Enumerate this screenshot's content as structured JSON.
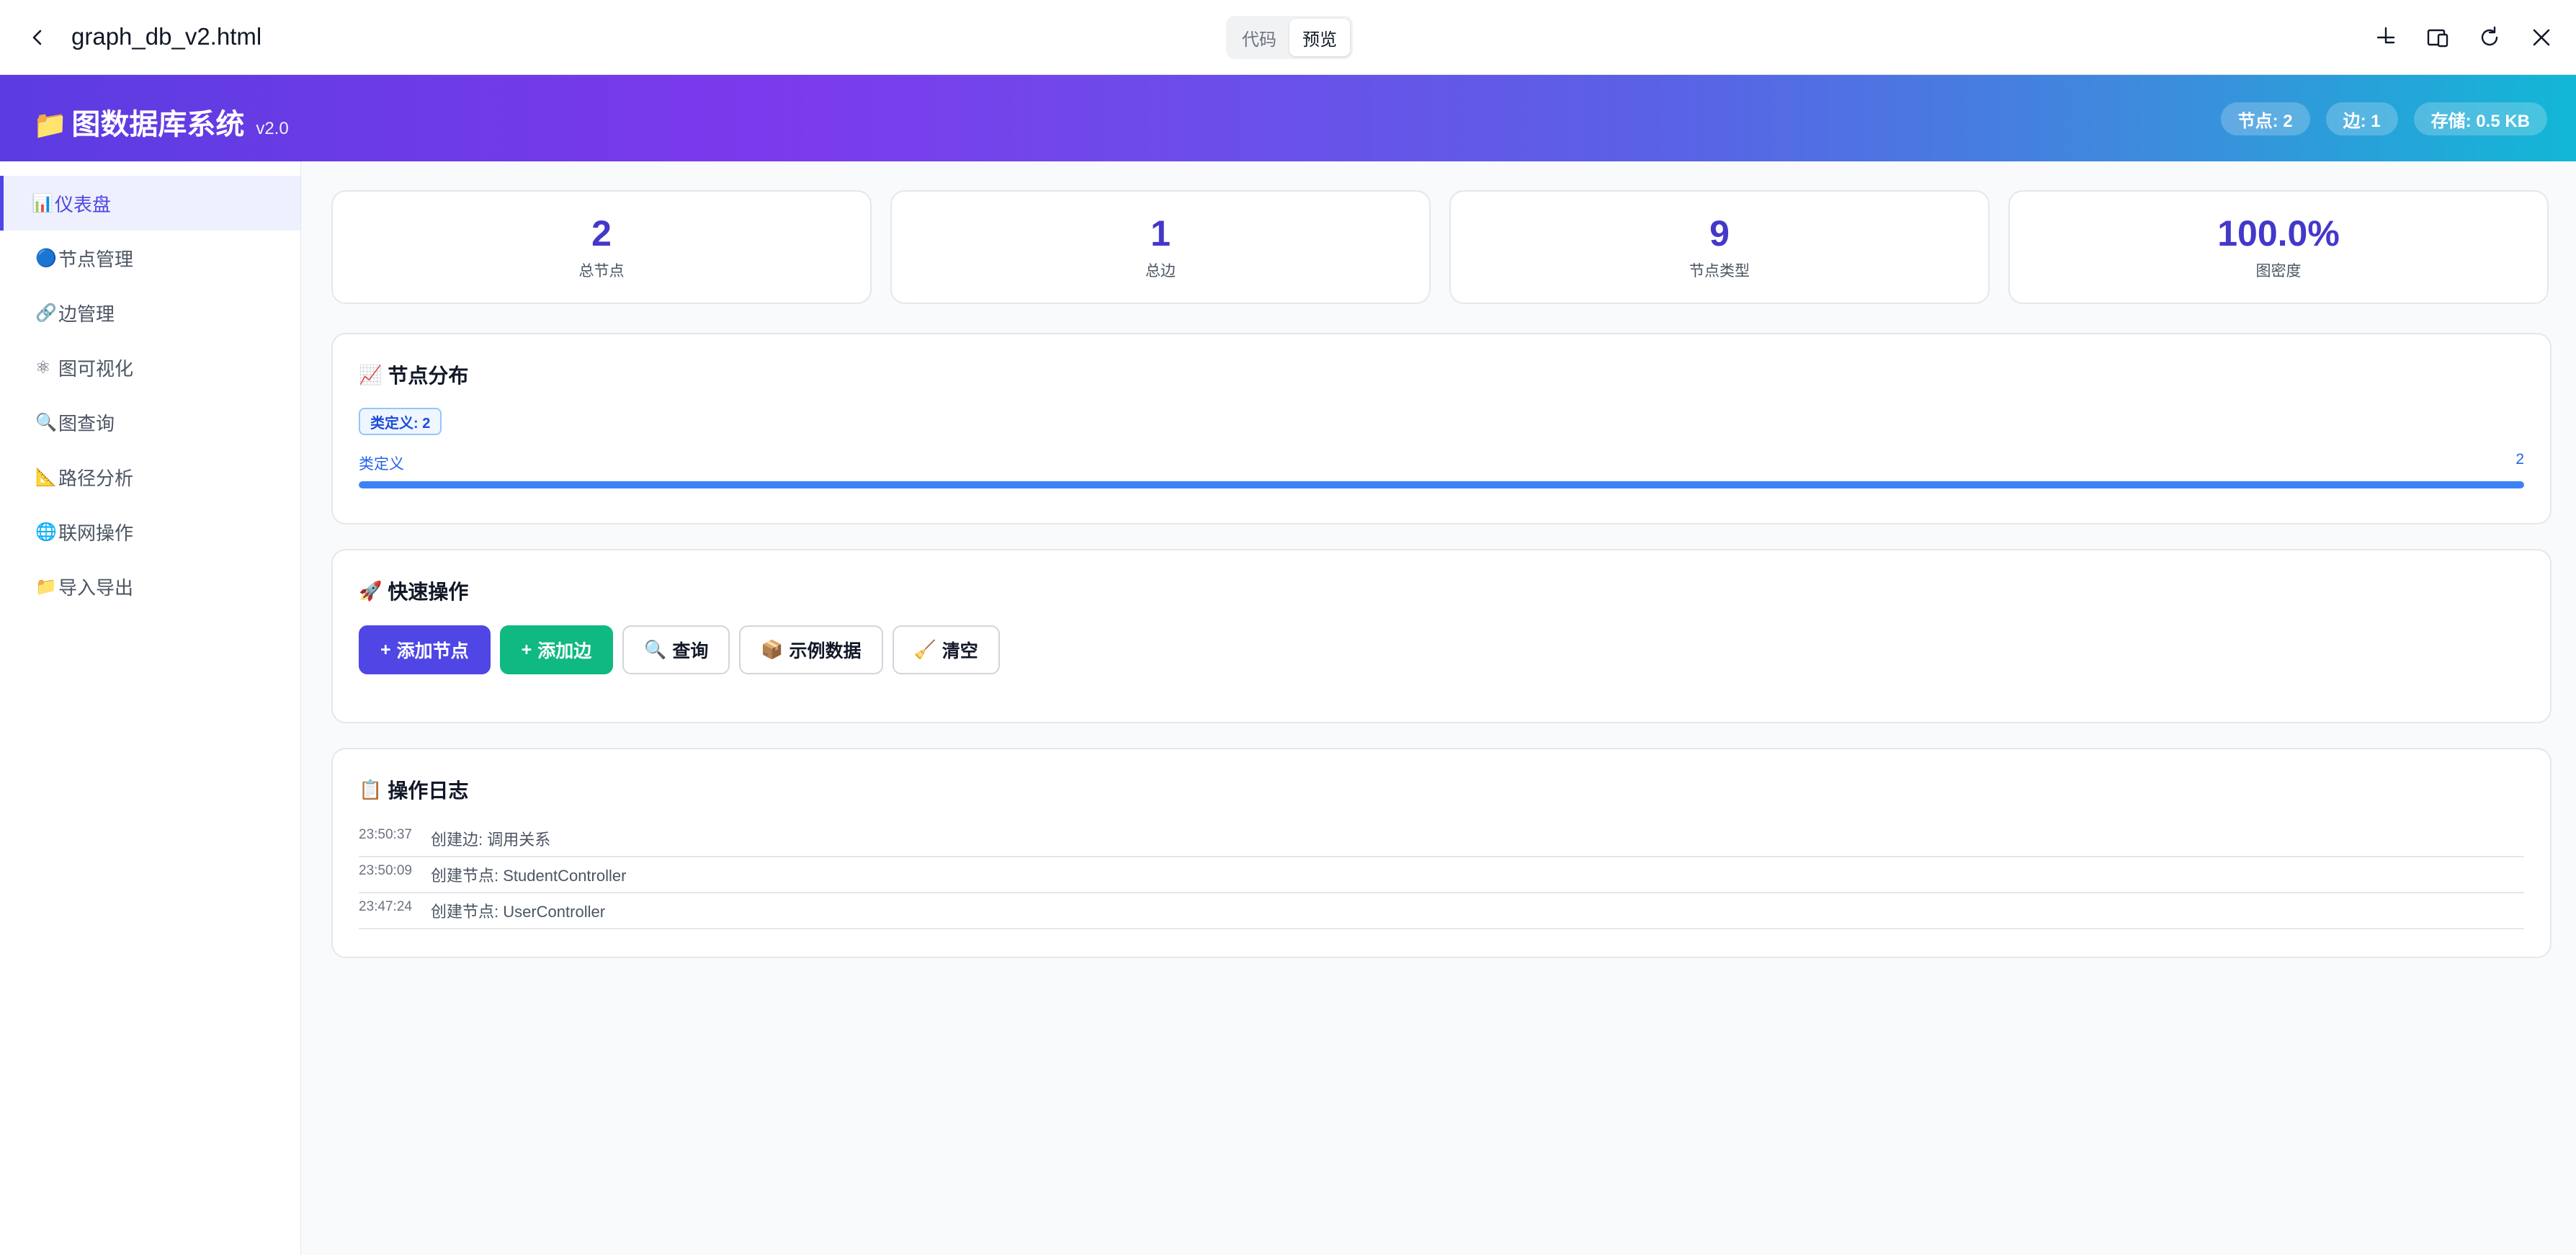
{
  "topbar": {
    "file_name": "graph_db_v2.html",
    "tabs": [
      {
        "label": "代码",
        "active": false
      },
      {
        "label": "预览",
        "active": true
      }
    ]
  },
  "header": {
    "icon": "📁",
    "title": "图数据库系统",
    "version": "v2.0",
    "stats": {
      "nodes": "节点: 2",
      "edges": "边: 1",
      "storage": "存储: 0.5 KB"
    }
  },
  "sidebar": {
    "items": [
      {
        "icon": "📊",
        "label": "仪表盘",
        "active": true
      },
      {
        "icon": "🔵",
        "label": "节点管理",
        "active": false
      },
      {
        "icon": "🔗",
        "label": "边管理",
        "active": false
      },
      {
        "icon": "⚛",
        "label": "图可视化",
        "active": false
      },
      {
        "icon": "🔍",
        "label": "图查询",
        "active": false
      },
      {
        "icon": "📐",
        "label": "路径分析",
        "active": false
      },
      {
        "icon": "🌐",
        "label": "联网操作",
        "active": false
      },
      {
        "icon": "📁",
        "label": "导入导出",
        "active": false
      }
    ]
  },
  "stats": [
    {
      "value": "2",
      "label": "总节点"
    },
    {
      "value": "1",
      "label": "总边"
    },
    {
      "value": "9",
      "label": "节点类型"
    },
    {
      "value": "100.0%",
      "label": "图密度"
    }
  ],
  "distribution": {
    "icon": "📈",
    "title": "节点分布",
    "badge": "类定义: 2",
    "bar_label": "类定义",
    "bar_value": "2",
    "bar_fraction": 1.0
  },
  "quick": {
    "icon": "🚀",
    "title": "快速操作",
    "buttons": {
      "add_node": "添加节点",
      "add_edge": "添加边",
      "query": "查询",
      "sample": "示例数据",
      "clear": "清空"
    }
  },
  "log": {
    "icon": "📋",
    "title": "操作日志",
    "entries": [
      {
        "time": "23:50:37",
        "text": "创建边: 调用关系"
      },
      {
        "time": "23:50:09",
        "text": "创建节点: StudentController"
      },
      {
        "time": "23:47:24",
        "text": "创建节点: UserController"
      }
    ]
  },
  "colors": {
    "accent": "#4f46e5",
    "success": "#10b981",
    "bar": "#3b82f6"
  }
}
